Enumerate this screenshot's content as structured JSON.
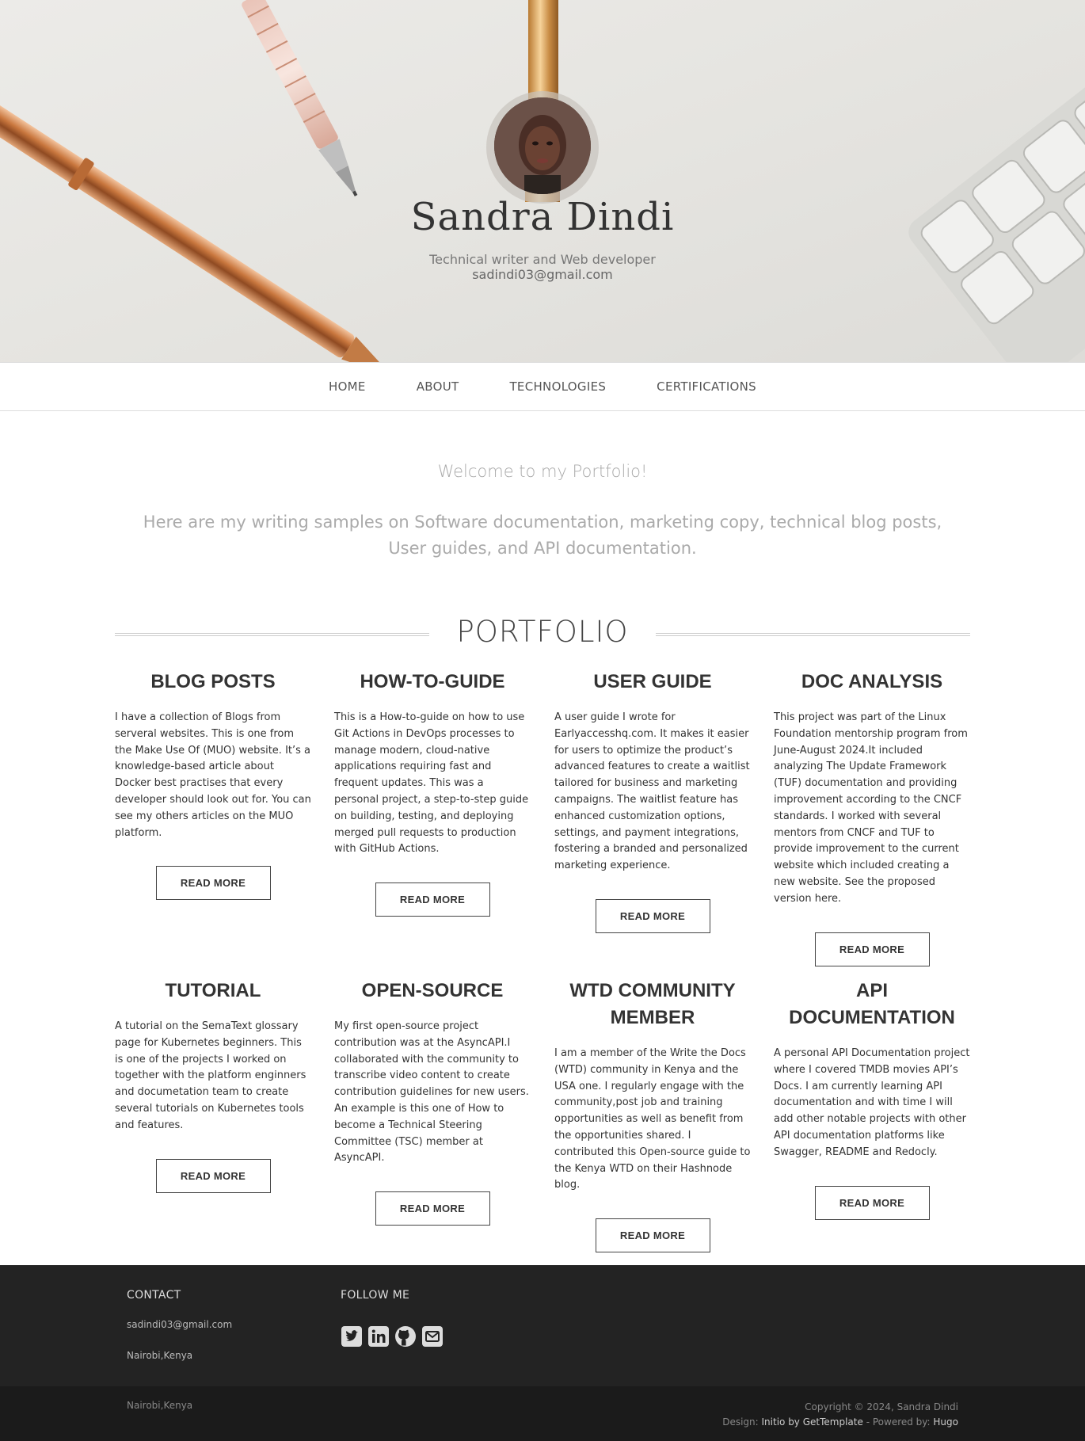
{
  "header": {
    "name": "Sandra Dindi",
    "description": "Technical writer and Web developer",
    "email": "sadindi03@gmail.com"
  },
  "nav": {
    "items": [
      "HOME",
      "ABOUT",
      "TECHNOLOGIES",
      "CERTIFICATIONS"
    ]
  },
  "intro": {
    "title": "Welcome to my Portfolio!",
    "text": "Here are my writing samples on Software documentation, marketing copy, technical blog posts, User guides, and API documentation."
  },
  "portfolio": {
    "heading": "PORTFOLIO",
    "button_label": "READ MORE",
    "items": [
      {
        "title": "BLOG POSTS",
        "text": "I have a collection of Blogs from serveral websites. This is one from the Make Use Of (MUO) website. It’s a knowledge-based article about Docker best practises that every developer should look out for. You can see my others articles on the MUO platform."
      },
      {
        "title": "HOW-TO-GUIDE",
        "text": "This is a How-to-guide on how to use Git Actions in DevOps processes to manage modern, cloud-native applications requiring fast and frequent updates. This was a personal project, a step-to-step guide on building, testing, and deploying merged pull requests to production with GitHub Actions."
      },
      {
        "title": "USER GUIDE",
        "text": "A user guide I wrote for Earlyaccesshq.com. It makes it easier for users to optimize the product’s advanced features to create a waitlist tailored for business and marketing campaigns. The waitlist feature has enhanced customization options, settings, and payment integrations, fostering a branded and personalized marketing experience."
      },
      {
        "title": "DOC ANALYSIS",
        "text": "This project was part of the Linux Foundation mentorship program from June-August 2024.It included analyzing The Update Framework (TUF) documentation and providing improvement according to the CNCF standards. I worked with several mentors from CNCF and TUF to provide improvement to the current website which included creating a new website. See the proposed version here."
      },
      {
        "title": "TUTORIAL",
        "text": "A tutorial on the SemaText glossary page for Kubernetes beginners. This is one of the projects I worked on together with the platform enginners and documetation team to create several tutorials on Kubernetes tools and features."
      },
      {
        "title": "OPEN-SOURCE",
        "text": "My first open-source project contribution was at the AsyncAPI.I collaborated with the community to transcribe video content to create contribution guidelines for new users. An example is this one of How to become a Technical Steering Committee (TSC) member at AsyncAPI."
      },
      {
        "title": "WTD COMMUNITY MEMBER",
        "text": "I am a member of the Write the Docs (WTD) community in Kenya and the USA one. I regularly engage with the community,post job and training opportunities as well as benefit from the opportunities shared. I contributed this Open-source guide to the Kenya WTD on their Hashnode blog."
      },
      {
        "title": "API DOCUMENTATION",
        "text": "A personal API Documentation project where I covered TMDB movies API’s Docs. I am currently learning API documentation and with time I will add other notable projects with other API documentation platforms like Swagger, README and Redocly."
      }
    ]
  },
  "footer": {
    "contact_heading": "CONTACT",
    "contact_email": "sadindi03@gmail.com",
    "contact_location": "Nairobi,Kenya",
    "follow_heading": "FOLLOW ME",
    "social_icons": [
      "twitter-icon",
      "linkedin-icon",
      "github-icon",
      "email-icon"
    ],
    "bottom_location": "Nairobi,Kenya",
    "copyright": "Copyright © 2024, Sandra Dindi",
    "design_label": "Design:",
    "design_link": "Initio by GetTemplate",
    "powered_label": "- Powered by:",
    "powered_link": "Hugo"
  }
}
